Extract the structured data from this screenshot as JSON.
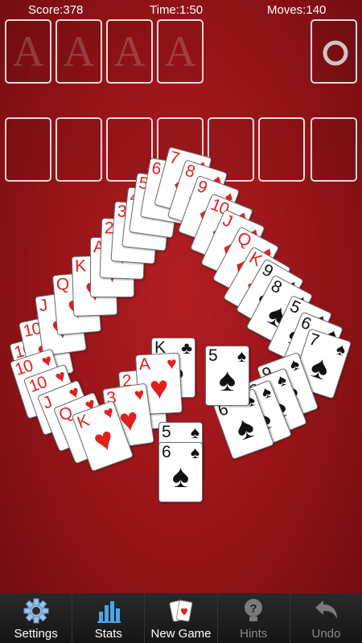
{
  "status": {
    "score": "Score:378",
    "time": "Time:1:50",
    "moves": "Moves:140"
  },
  "foundation": {
    "placeholder": "A"
  },
  "colors": {
    "red_suit": "#e0201f",
    "black_suit": "#111111",
    "felt": "#9a1519"
  },
  "cards": [
    {
      "rank": "10",
      "suit": "♥"
    },
    {
      "rank": "10",
      "suit": "♥"
    },
    {
      "rank": "J",
      "suit": "♥"
    },
    {
      "rank": "Q",
      "suit": "♥"
    },
    {
      "rank": "K",
      "suit": "♥"
    },
    {
      "rank": "A",
      "suit": "♥"
    },
    {
      "rank": "2",
      "suit": "♥"
    },
    {
      "rank": "3",
      "suit": "♥"
    },
    {
      "rank": "4",
      "suit": "♥"
    },
    {
      "rank": "5",
      "suit": "♥"
    },
    {
      "rank": "6",
      "suit": "♥"
    },
    {
      "rank": "7",
      "suit": "♦"
    },
    {
      "rank": "8",
      "suit": "♦"
    },
    {
      "rank": "9",
      "suit": "♦"
    },
    {
      "rank": "10",
      "suit": "♦"
    },
    {
      "rank": "J",
      "suit": "♦"
    },
    {
      "rank": "Q",
      "suit": "♦"
    },
    {
      "rank": "K",
      "suit": "♦"
    },
    {
      "rank": "K",
      "suit": "♣"
    },
    {
      "rank": "A",
      "suit": "♥"
    },
    {
      "rank": "2",
      "suit": "♥"
    },
    {
      "rank": "3",
      "suit": "♥"
    },
    {
      "rank": "5",
      "suit": "♠"
    },
    {
      "rank": "6",
      "suit": "♠"
    },
    {
      "rank": "7",
      "suit": "♠"
    },
    {
      "rank": "8",
      "suit": "♠"
    },
    {
      "rank": "9",
      "suit": "♠"
    }
  ],
  "toolbar": {
    "settings": "Settings",
    "stats": "Stats",
    "new_game": "New Game",
    "hints": "Hints",
    "undo": "Undo"
  }
}
